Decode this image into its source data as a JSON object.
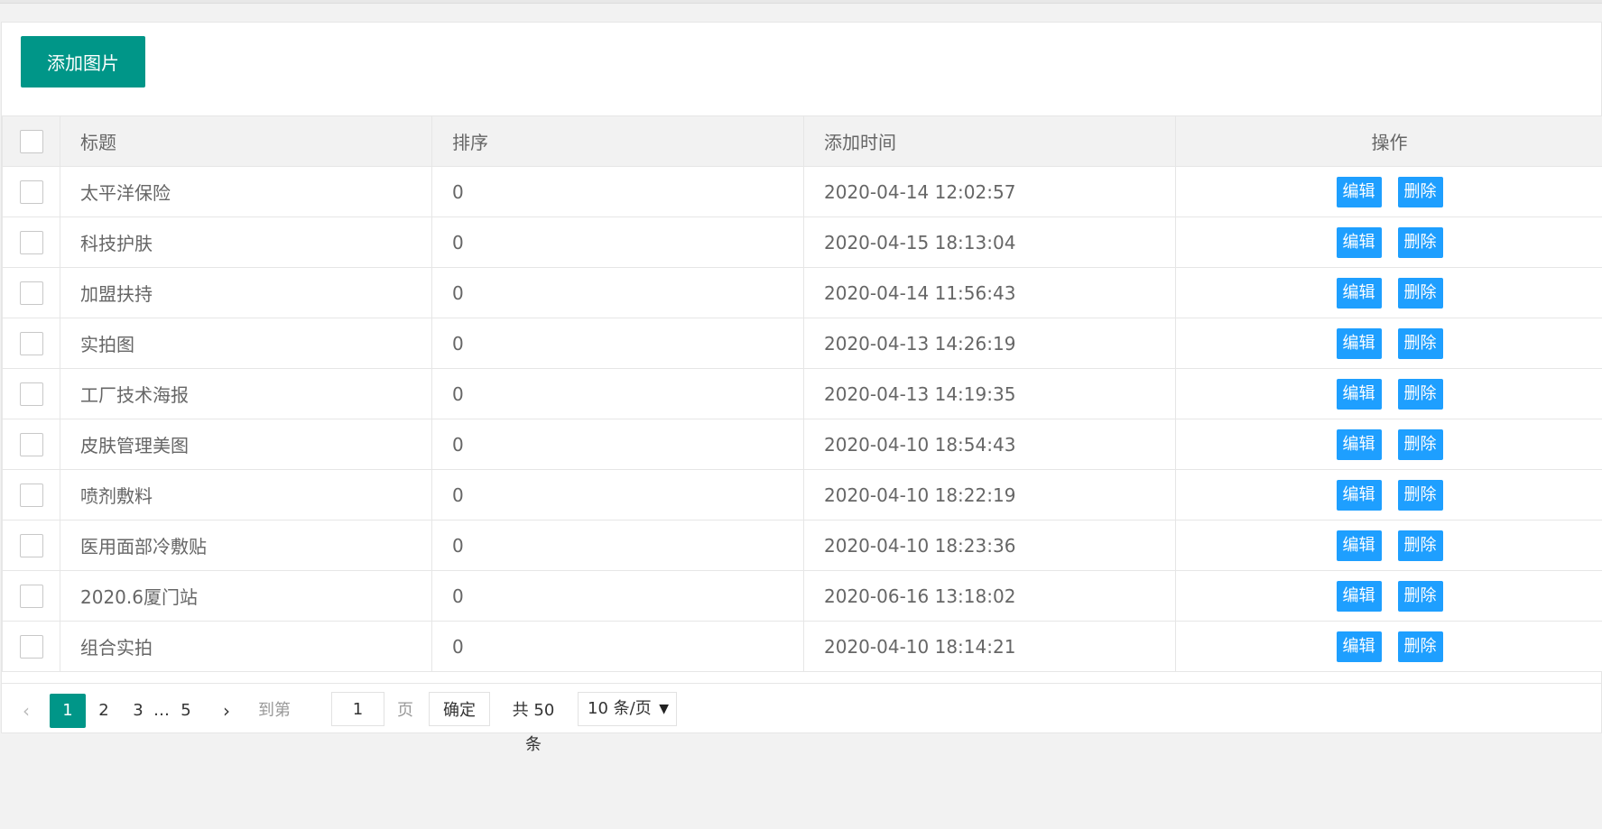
{
  "toolbar": {
    "add_label": "添加图片"
  },
  "table": {
    "headers": {
      "title": "标题",
      "sort": "排序",
      "time": "添加时间",
      "ops": "操作"
    },
    "edit_label": "编辑",
    "delete_label": "删除",
    "rows": [
      {
        "title": "太平洋保险",
        "sort": "0",
        "time": "2020-04-14 12:02:57"
      },
      {
        "title": "科技护肤",
        "sort": "0",
        "time": "2020-04-15 18:13:04"
      },
      {
        "title": "加盟扶持",
        "sort": "0",
        "time": "2020-04-14 11:56:43"
      },
      {
        "title": "实拍图",
        "sort": "0",
        "time": "2020-04-13 14:26:19"
      },
      {
        "title": "工厂技术海报",
        "sort": "0",
        "time": "2020-04-13 14:19:35"
      },
      {
        "title": "皮肤管理美图",
        "sort": "0",
        "time": "2020-04-10 18:54:43"
      },
      {
        "title": "喷剂敷料",
        "sort": "0",
        "time": "2020-04-10 18:22:19"
      },
      {
        "title": "医用面部冷敷贴",
        "sort": "0",
        "time": "2020-04-10 18:23:36"
      },
      {
        "title": "2020.6厦门站",
        "sort": "0",
        "time": "2020-06-16 13:18:02"
      },
      {
        "title": "组合实拍",
        "sort": "0",
        "time": "2020-04-10 18:14:21"
      }
    ]
  },
  "pager": {
    "prev": "‹",
    "next": "›",
    "pages": [
      "1",
      "2",
      "3"
    ],
    "ellipsis": "…",
    "last_page": "5",
    "current": "1",
    "goto_prefix": "到第",
    "goto_value": "1",
    "goto_suffix": "页",
    "confirm_label": "确定",
    "total": "共 50 条",
    "page_size": "10 条/页"
  }
}
